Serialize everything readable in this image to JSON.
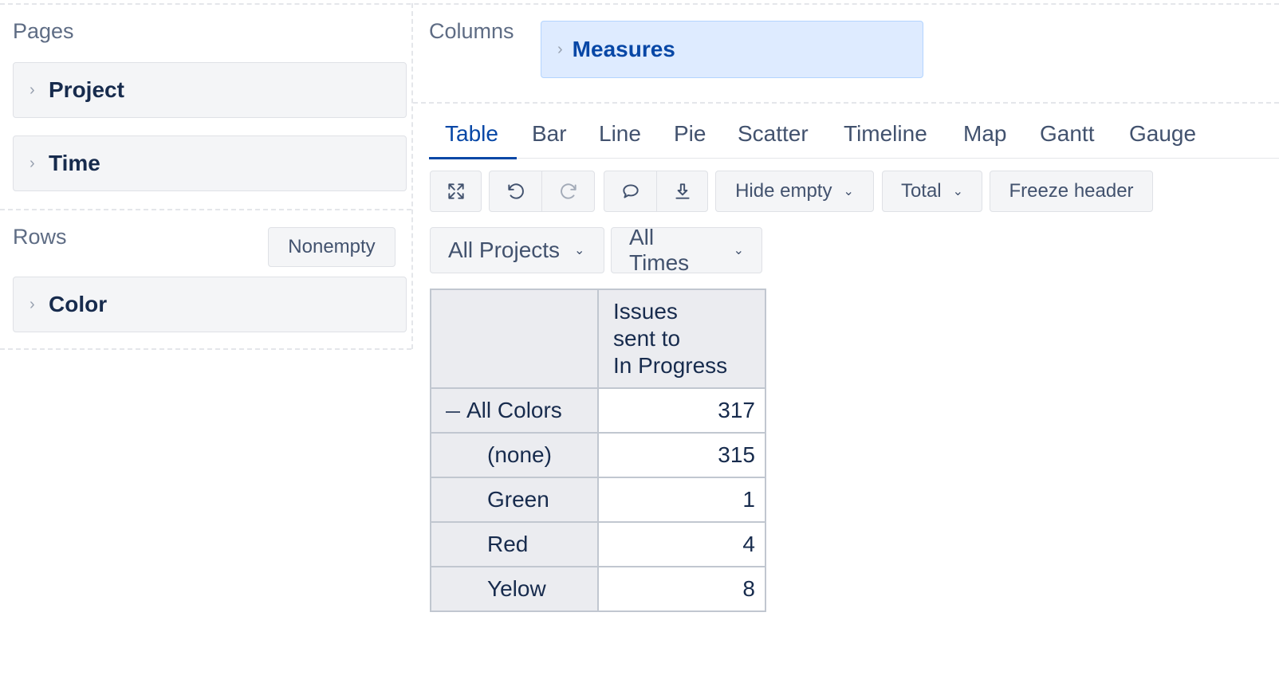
{
  "pages": {
    "title": "Pages",
    "items": [
      {
        "label": "Project"
      },
      {
        "label": "Time"
      }
    ]
  },
  "rows": {
    "title": "Rows",
    "nonempty_label": "Nonempty",
    "items": [
      {
        "label": "Color"
      }
    ]
  },
  "columns": {
    "title": "Columns",
    "items": [
      {
        "label": "Measures"
      }
    ]
  },
  "tabs": [
    "Table",
    "Bar",
    "Line",
    "Pie",
    "Scatter",
    "Timeline",
    "Map",
    "Gantt",
    "Gauge"
  ],
  "active_tab": "Table",
  "toolbar": {
    "hide_empty": "Hide empty",
    "total": "Total",
    "freeze_header": "Freeze header",
    "icons": [
      "fullscreen-icon",
      "undo-icon",
      "redo-icon",
      "comment-icon",
      "download-icon"
    ]
  },
  "filters": {
    "projects": "All Projects",
    "times": "All Times"
  },
  "table": {
    "column_header": [
      "Issues",
      "sent to",
      "In Progress"
    ],
    "rows": [
      {
        "label": "All Colors",
        "value": "317"
      },
      {
        "label": "(none)",
        "value": "315"
      },
      {
        "label": "Green",
        "value": "1"
      },
      {
        "label": "Red",
        "value": "4"
      },
      {
        "label": "Yelow",
        "value": "8"
      }
    ]
  },
  "colors": {
    "accent": "#0747a6",
    "measures_bg": "#deebff",
    "panel_bg": "#f4f5f7"
  }
}
